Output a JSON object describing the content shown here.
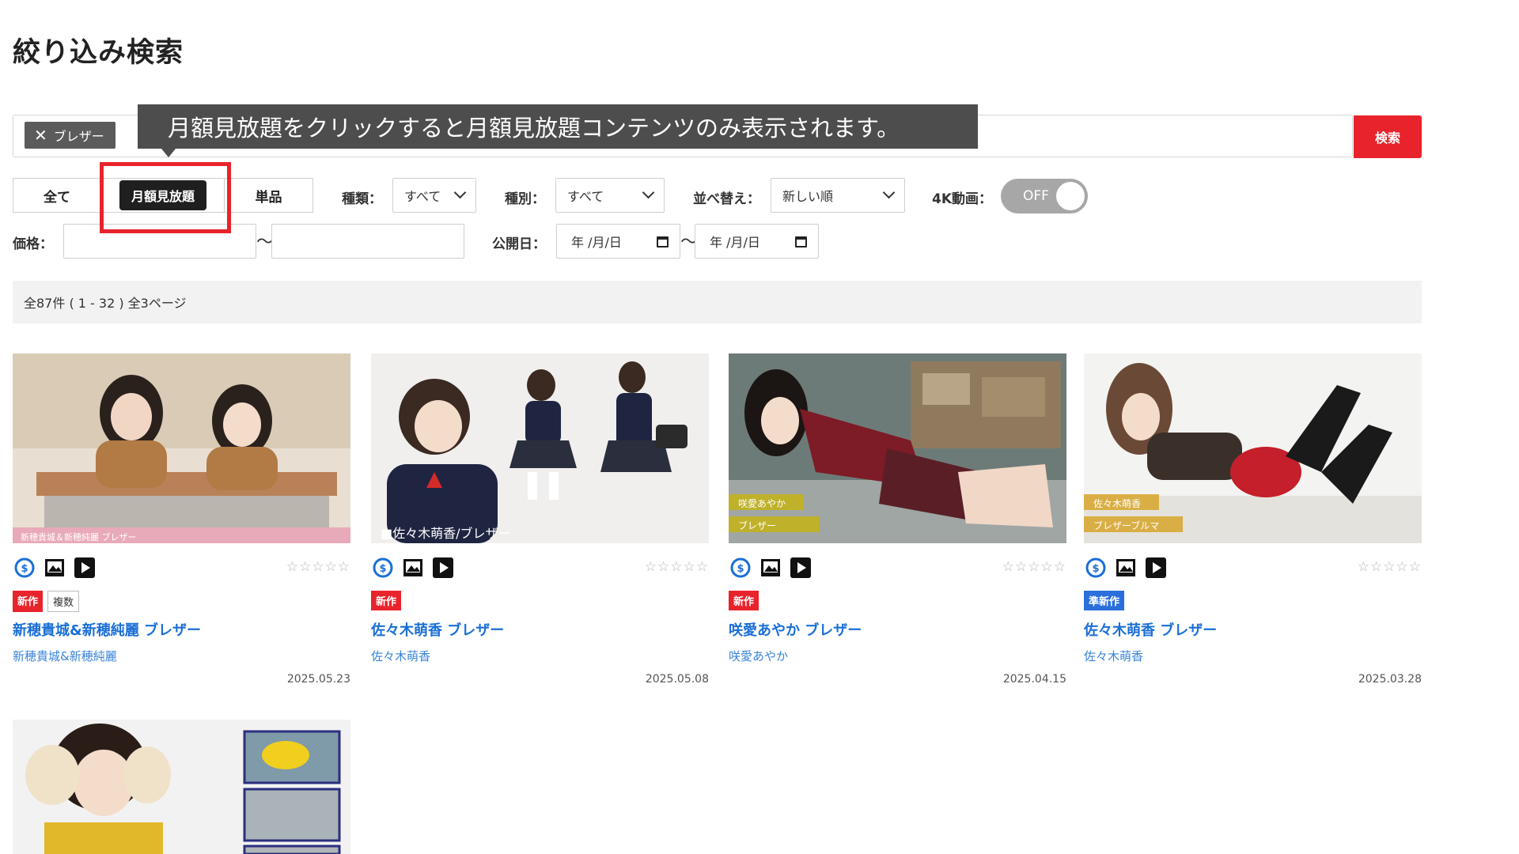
{
  "page": {
    "title": "絞り込み検索"
  },
  "search": {
    "tag": "ブレザー",
    "button": "検索"
  },
  "tooltip": {
    "text": "月額見放題をクリックすると月額見放題コンテンツのみ表示されます。"
  },
  "filters": {
    "type_buttons": {
      "all": "全て",
      "monthly": "月額見放題",
      "single": "単品"
    },
    "kind_label": "種類：",
    "kind_value": "すべて",
    "category_label": "種別：",
    "category_value": "すべて",
    "sort_label": "並べ替え：",
    "sort_value": "新しい順",
    "fourk_label": "4K動画：",
    "fourk_value": "OFF",
    "price_label": "価格：",
    "tilde": "〜",
    "release_label": "公開日：",
    "date_placeholder": "年 /月/日"
  },
  "results": {
    "summary": "全87件 ( 1 - 32 )  全3ページ"
  },
  "stars": "☆☆☆☆☆",
  "cards": [
    {
      "thumb_label": "新穂貴城＆新穂純麗 ブレザー",
      "badges": [
        "新作",
        "複数"
      ],
      "title": "新穂貴城&新穂純麗 ブレザー",
      "actress": "新穂貴城&新穂純麗",
      "date": "2025.05.23"
    },
    {
      "thumb_label": "■佐々木萌香/ブレザー",
      "badges": [
        "新作"
      ],
      "title": "佐々木萌香 ブレザー",
      "actress": "佐々木萌香",
      "date": "2025.05.08"
    },
    {
      "thumb_label_1": "咲愛あやか",
      "thumb_label_2": "ブレザー",
      "badges": [
        "新作"
      ],
      "title": "咲愛あやか ブレザー",
      "actress": "咲愛あやか",
      "date": "2025.04.15"
    },
    {
      "thumb_label_1": "佐々木萌香",
      "thumb_label_2": "ブレザーブルマ",
      "badges": [
        "準新作"
      ],
      "title": "佐々木萌香 ブレザー",
      "actress": "佐々木萌香",
      "date": "2025.03.28"
    }
  ],
  "colors": {
    "accent_red": "#e8232b",
    "link_blue": "#1a6fd6",
    "tooltip_bg": "#4d4d4d",
    "badge_blue": "#2a6fdb"
  }
}
